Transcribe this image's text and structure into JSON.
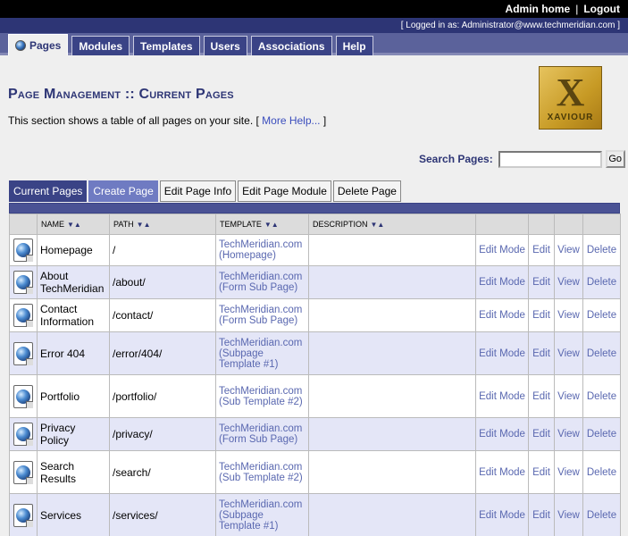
{
  "topnav": {
    "admin_home": "Admin home",
    "separator": "|",
    "logout": "Logout"
  },
  "status": {
    "logged_in": "[ Logged in as: Administrator@www.techmeridian.com ]"
  },
  "tabs": [
    {
      "label": "Pages",
      "active": true
    },
    {
      "label": "Modules"
    },
    {
      "label": "Templates"
    },
    {
      "label": "Users"
    },
    {
      "label": "Associations"
    },
    {
      "label": "Help"
    }
  ],
  "page": {
    "title": "Page Management :: Current Pages",
    "description": "This section shows a table of all pages on your site. [ ",
    "help_link": "More Help...",
    "description_end": " ]"
  },
  "logo": {
    "letter": "X",
    "name": "XAVIOUR"
  },
  "search": {
    "label": "Search Pages:",
    "value": "",
    "button": "Go"
  },
  "subtabs": [
    "Current Pages",
    "Create Page",
    "Edit Page Info",
    "Edit Page Module",
    "Delete Page"
  ],
  "table": {
    "columns": [
      "NAME",
      "PATH",
      "TEMPLATE",
      "DESCRIPTION"
    ],
    "actions": [
      "Edit Mode",
      "Edit",
      "View",
      "Delete"
    ],
    "rows": [
      {
        "name": "Homepage",
        "path": "/",
        "template": "TechMeridian.com (Homepage)",
        "description": ""
      },
      {
        "name": "About TechMeridian",
        "path": "/about/",
        "template": "TechMeridian.com (Form Sub Page)",
        "description": ""
      },
      {
        "name": "Contact Information",
        "path": "/contact/",
        "template": "TechMeridian.com (Form Sub Page)",
        "description": ""
      },
      {
        "name": "Error 404",
        "path": "/error/404/",
        "template": "TechMeridian.com (Subpage Template #1)",
        "description": ""
      },
      {
        "name": "Portfolio",
        "path": "/portfolio/",
        "template": "TechMeridian.com (Sub Template #2)",
        "description": ""
      },
      {
        "name": "Privacy Policy",
        "path": "/privacy/",
        "template": "TechMeridian.com (Form Sub Page)",
        "description": ""
      },
      {
        "name": "Search Results",
        "path": "/search/",
        "template": "TechMeridian.com (Sub Template #2)",
        "description": ""
      },
      {
        "name": "Services",
        "path": "/services/",
        "template": "TechMeridian.com (Subpage Template #1)",
        "description": ""
      }
    ]
  }
}
